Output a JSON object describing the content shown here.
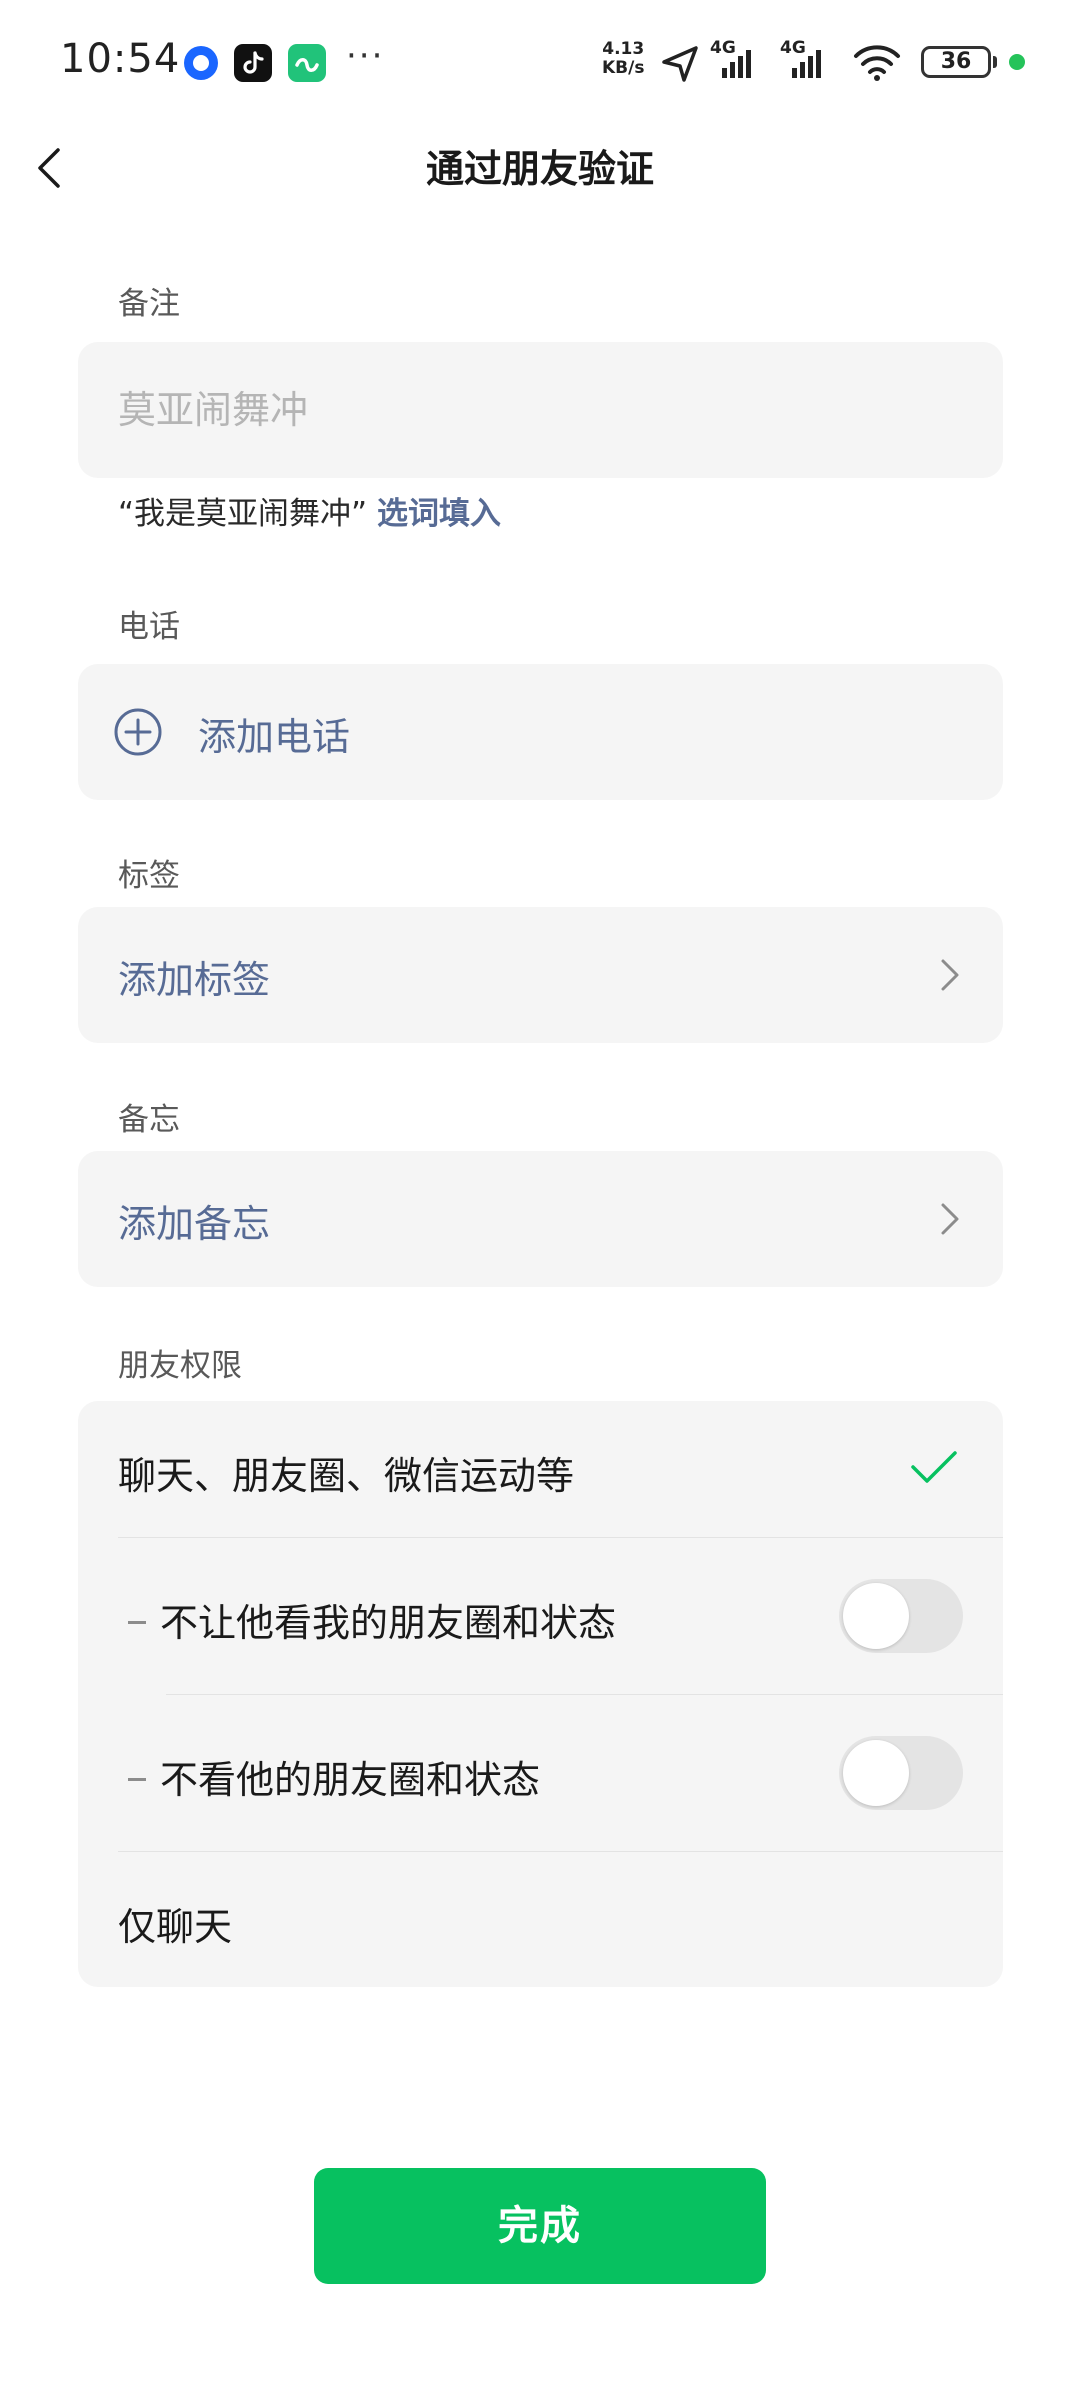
{
  "status_bar": {
    "time": "10:54",
    "more_dots": "···",
    "net_speed_value": "4.13",
    "net_speed_unit": "KB/s",
    "network_1": "4G",
    "network_2": "4G",
    "battery": "36",
    "app_icons": [
      "browser-app-icon",
      "tiktok-app-icon",
      "green-app-icon"
    ]
  },
  "nav": {
    "title": "通过朋友验证"
  },
  "remark": {
    "label": "备注",
    "placeholder": "莫亚闹舞冲",
    "value": "",
    "hint_prefix": "“我是莫亚闹舞冲”",
    "hint_link": "选词填入"
  },
  "phone": {
    "label": "电话",
    "add_text": "添加电话"
  },
  "tags": {
    "label": "标签",
    "add_text": "添加标签"
  },
  "memo": {
    "label": "备忘",
    "add_text": "添加备忘"
  },
  "permissions": {
    "label": "朋友权限",
    "option_all": "聊天、朋友圈、微信运动等",
    "option_all_selected": true,
    "hide_my_moments": "不让他看我的朋友圈和状态",
    "hide_my_moments_on": false,
    "hide_their_moments": "不看他的朋友圈和状态",
    "hide_their_moments_on": false,
    "option_chat_only": "仅聊天"
  },
  "done_button": "完成",
  "colors": {
    "accent_green": "#07c160",
    "link_blue": "#576b95",
    "card_bg": "#f5f5f5"
  }
}
